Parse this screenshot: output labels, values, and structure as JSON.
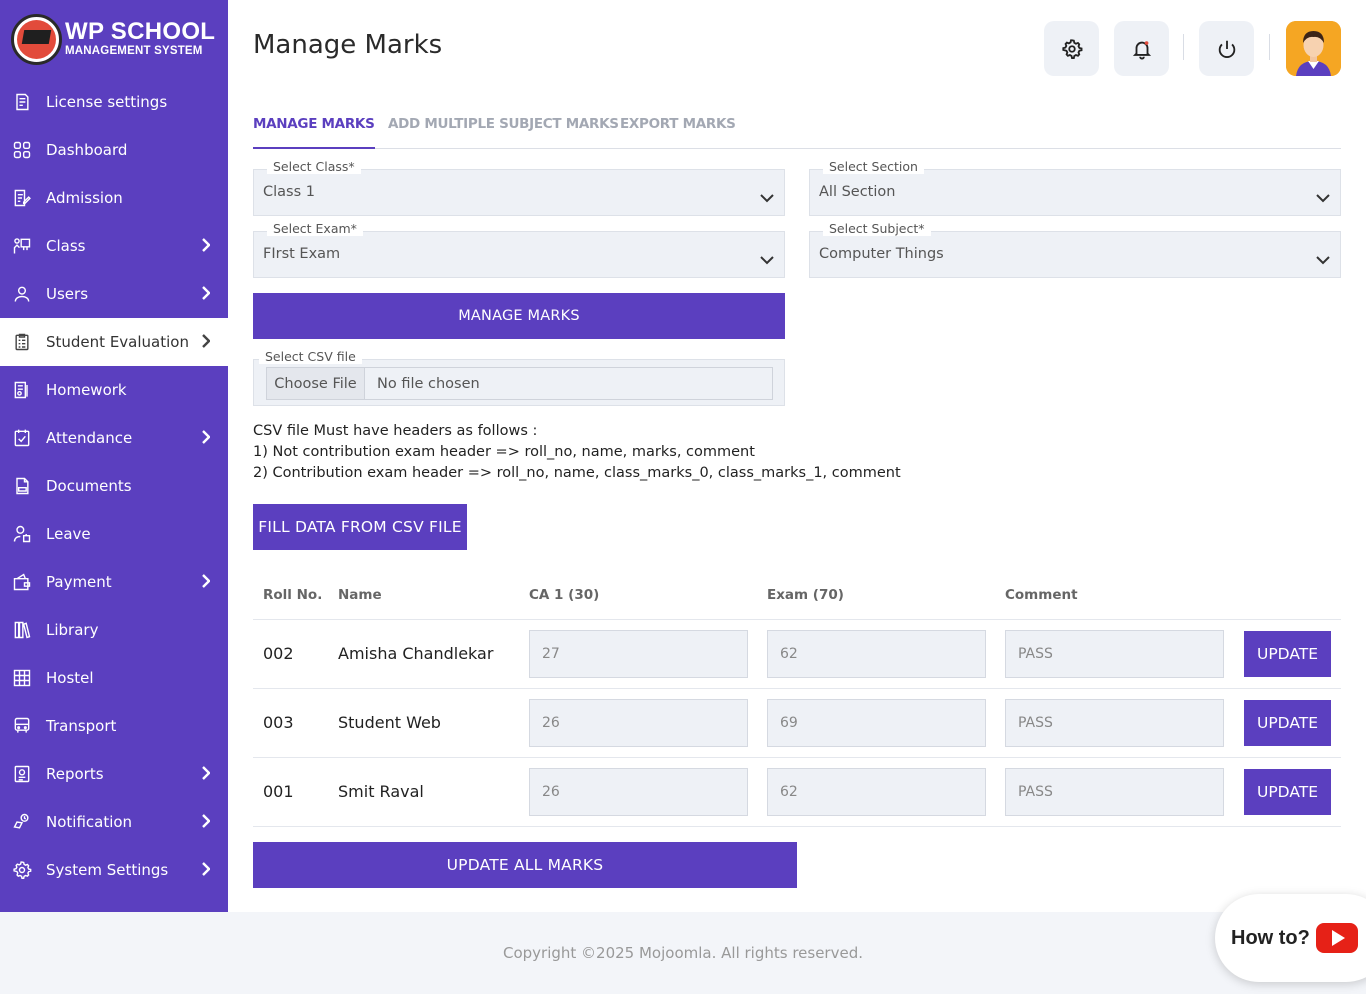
{
  "brand": {
    "title": "WP SCHOOL",
    "subtitle": "MANAGEMENT SYSTEM"
  },
  "sidebar": {
    "items": [
      {
        "label": "License settings",
        "icon": "license-icon",
        "has_submenu": false
      },
      {
        "label": "Dashboard",
        "icon": "dashboard-icon",
        "has_submenu": false
      },
      {
        "label": "Admission",
        "icon": "admission-icon",
        "has_submenu": false
      },
      {
        "label": "Class",
        "icon": "class-icon",
        "has_submenu": true
      },
      {
        "label": "Users",
        "icon": "user-icon",
        "has_submenu": true
      },
      {
        "label": "Student Evaluation",
        "icon": "evaluation-icon",
        "has_submenu": true,
        "active": true
      },
      {
        "label": "Homework",
        "icon": "homework-icon",
        "has_submenu": false
      },
      {
        "label": "Attendance",
        "icon": "attendance-icon",
        "has_submenu": true
      },
      {
        "label": "Documents",
        "icon": "documents-icon",
        "has_submenu": false
      },
      {
        "label": "Leave",
        "icon": "leave-icon",
        "has_submenu": false
      },
      {
        "label": "Payment",
        "icon": "payment-icon",
        "has_submenu": true
      },
      {
        "label": "Library",
        "icon": "library-icon",
        "has_submenu": false
      },
      {
        "label": "Hostel",
        "icon": "hostel-icon",
        "has_submenu": false
      },
      {
        "label": "Transport",
        "icon": "transport-icon",
        "has_submenu": false
      },
      {
        "label": "Reports",
        "icon": "reports-icon",
        "has_submenu": true
      },
      {
        "label": "Notification",
        "icon": "notification-icon",
        "has_submenu": true
      },
      {
        "label": "System Settings",
        "icon": "settings-icon",
        "has_submenu": true
      }
    ]
  },
  "header": {
    "title": "Manage Marks"
  },
  "tabs": [
    {
      "label": "MANAGE MARKS",
      "active": true
    },
    {
      "label": "ADD MULTIPLE SUBJECT MARKS",
      "active": false
    },
    {
      "label": "EXPORT MARKS",
      "active": false
    }
  ],
  "form": {
    "class": {
      "label": "Select Class*",
      "value": "Class 1"
    },
    "section": {
      "label": "Select Section",
      "value": "All Section"
    },
    "exam": {
      "label": "Select Exam*",
      "value": "FIrst Exam"
    },
    "subject": {
      "label": "Select Subject*",
      "value": "Computer Things"
    },
    "manage_button": "MANAGE MARKS",
    "csv": {
      "label": "Select CSV file",
      "choose": "Choose File",
      "status": "No file chosen"
    },
    "csv_note": [
      "CSV file Must have headers as follows :",
      "1) Not contribution exam header => roll_no, name, marks, comment",
      "2) Contribution exam header => roll_no, name, class_marks_0, class_marks_1, comment"
    ],
    "fill_button": "FILL DATA FROM CSV FILE"
  },
  "table": {
    "headers": [
      "Roll No.",
      "Name",
      "CA 1 (30)",
      "Exam (70)",
      "Comment"
    ],
    "rows": [
      {
        "roll": "002",
        "name": "Amisha Chandlekar",
        "ca": "27",
        "exam": "62",
        "comment": "PASS",
        "action": "UPDATE"
      },
      {
        "roll": "003",
        "name": "Student Web",
        "ca": "26",
        "exam": "69",
        "comment": "PASS",
        "action": "UPDATE"
      },
      {
        "roll": "001",
        "name": "Smit Raval",
        "ca": "26",
        "exam": "62",
        "comment": "PASS",
        "action": "UPDATE"
      }
    ],
    "update_all": "UPDATE ALL MARKS"
  },
  "footer": {
    "copyright": "Copyright ©2025 Mojoomla. All rights reserved."
  },
  "help": {
    "label": "How to?"
  },
  "colors": {
    "primary": "#5b3fbf",
    "field_bg": "#eef1f6",
    "youtube_red": "#e62117",
    "avatar_bg": "#f5a623"
  }
}
